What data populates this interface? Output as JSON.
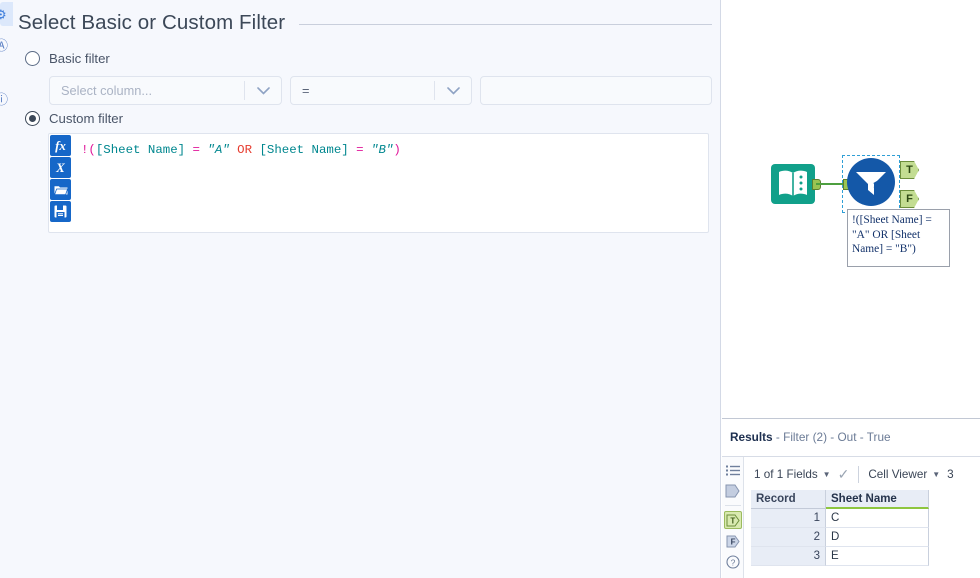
{
  "config": {
    "title": "Select Basic or Custom Filter",
    "basic": {
      "radio_label": "Basic filter",
      "column_placeholder": "Select column...",
      "operator_value": "=",
      "value_text": ""
    },
    "custom": {
      "radio_label": "Custom filter",
      "expression": "!([Sheet Name] = \"A\" OR [Sheet Name] = \"B\")",
      "tokens": [
        {
          "text": "!(",
          "type": "op"
        },
        {
          "text": "[Sheet Name]",
          "type": "fld"
        },
        {
          "text": " ",
          "type": "pl"
        },
        {
          "text": "=",
          "type": "op"
        },
        {
          "text": " ",
          "type": "pl"
        },
        {
          "text": "\"A\"",
          "type": "str"
        },
        {
          "text": " ",
          "type": "pl"
        },
        {
          "text": "OR",
          "type": "kw"
        },
        {
          "text": " ",
          "type": "pl"
        },
        {
          "text": "[Sheet Name]",
          "type": "fld"
        },
        {
          "text": " ",
          "type": "pl"
        },
        {
          "text": "=",
          "type": "op"
        },
        {
          "text": " ",
          "type": "pl"
        },
        {
          "text": "\"B\"",
          "type": "str"
        },
        {
          "text": ")",
          "type": "op"
        }
      ],
      "editor_buttons": [
        {
          "name": "insert-function-button",
          "glyph": "fx"
        },
        {
          "name": "insert-variable-button",
          "glyph": "x"
        },
        {
          "name": "open-expression-button",
          "glyph": "folder"
        },
        {
          "name": "save-expression-button",
          "glyph": "save"
        }
      ]
    },
    "rail_icons": [
      {
        "name": "configuration-gear-icon",
        "glyph": "⚙",
        "active": true
      },
      {
        "name": "annotation-icon",
        "glyph": "Ⓐ",
        "active": false
      },
      {
        "name": "chevron-icon",
        "glyph": "›",
        "active": false
      },
      {
        "name": "help-icon",
        "glyph": "ⓘ",
        "active": false
      }
    ]
  },
  "canvas": {
    "input_node": {
      "label": "",
      "icon": "input-data-icon",
      "color": "#11a08a"
    },
    "filter_node": {
      "icon": "filter-tool-icon",
      "color": "#1458a8",
      "selected": true
    },
    "output_ports": [
      {
        "label": "T",
        "name": "true-output-port"
      },
      {
        "label": "F",
        "name": "false-output-port"
      }
    ],
    "annotation": "!([Sheet Name] = \"A\" OR [Sheet Name] = \"B\")",
    "connection_color": "#4d9f3f"
  },
  "results": {
    "title_bold": "Results",
    "title_rest": " - Filter (2) - Out - True",
    "toolbar": {
      "fields_label": "1 of 1 Fields",
      "viewer_label": "Cell Viewer",
      "record_count": "3"
    },
    "rail_icons": [
      {
        "name": "messages-list-icon",
        "glyph": "list",
        "active": false
      },
      {
        "name": "data-output-icon",
        "glyph": "tag",
        "active": false
      },
      {
        "name": "true-output-icon",
        "glyph": "T",
        "active": true
      },
      {
        "name": "false-output-icon",
        "glyph": "F",
        "active": false
      },
      {
        "name": "help-icon",
        "glyph": "?",
        "active": false
      }
    ],
    "table": {
      "columns": [
        "Record",
        "Sheet Name"
      ],
      "rows": [
        {
          "record": "1",
          "sheet_name": "C"
        },
        {
          "record": "2",
          "sheet_name": "D"
        },
        {
          "record": "3",
          "sheet_name": "E"
        }
      ]
    }
  }
}
